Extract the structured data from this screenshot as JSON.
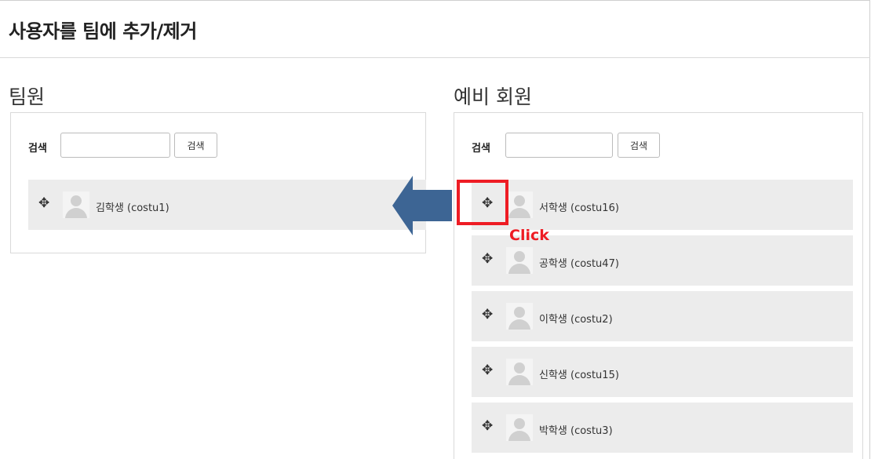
{
  "page_title": "사용자를 팀에 추가/제거",
  "members_panel": {
    "title": "팀원",
    "search_label": "검색",
    "search_value": "",
    "search_button": "검색",
    "users": [
      {
        "name": "김학생 (costu1)"
      }
    ]
  },
  "candidates_panel": {
    "title": "예비 회원",
    "search_label": "검색",
    "search_value": "",
    "search_button": "검색",
    "users": [
      {
        "name": "서학생 (costu16)"
      },
      {
        "name": "공학생 (costu47)"
      },
      {
        "name": "이학생 (costu2)"
      },
      {
        "name": "신학생 (costu15)"
      },
      {
        "name": "박학생 (costu3)"
      }
    ]
  },
  "annotation": {
    "click_label": "Click",
    "arrow_color": "#3d6594",
    "highlight_color": "#ee1c24"
  },
  "icons": {
    "move_icon": "move-icon",
    "avatar": "default-user-avatar"
  }
}
